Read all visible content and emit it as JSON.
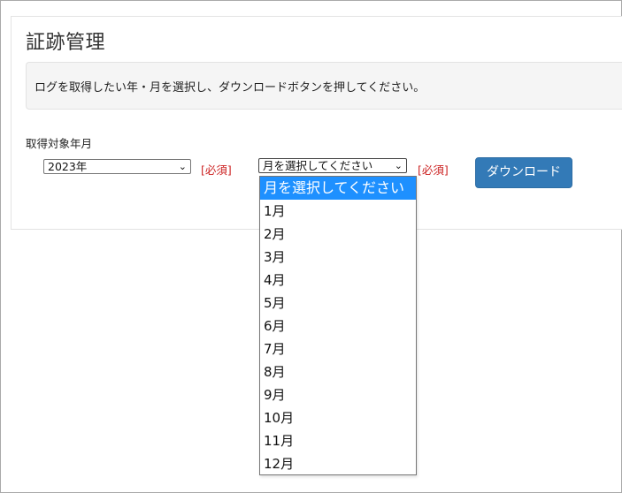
{
  "page": {
    "title": "証跡管理",
    "notice": "ログを取得したい年・月を選択し、ダウンロードボタンを押してください。"
  },
  "form": {
    "label": "取得対象年月",
    "year_select": {
      "value": "2023年"
    },
    "year_required": "[必須]",
    "month_select": {
      "value": "月を選択してください"
    },
    "month_required": "[必須]",
    "download_label": "ダウンロード"
  },
  "month_options": [
    "月を選択してください",
    "1月",
    "2月",
    "3月",
    "4月",
    "5月",
    "6月",
    "7月",
    "8月",
    "9月",
    "10月",
    "11月",
    "12月"
  ],
  "icons": {
    "select_chevron": "chevron-down-icon"
  },
  "colors": {
    "button": "#337ab7",
    "required": "#cc2222",
    "selected_option": "#1e90ff",
    "notice_bg": "#f5f5f5"
  }
}
